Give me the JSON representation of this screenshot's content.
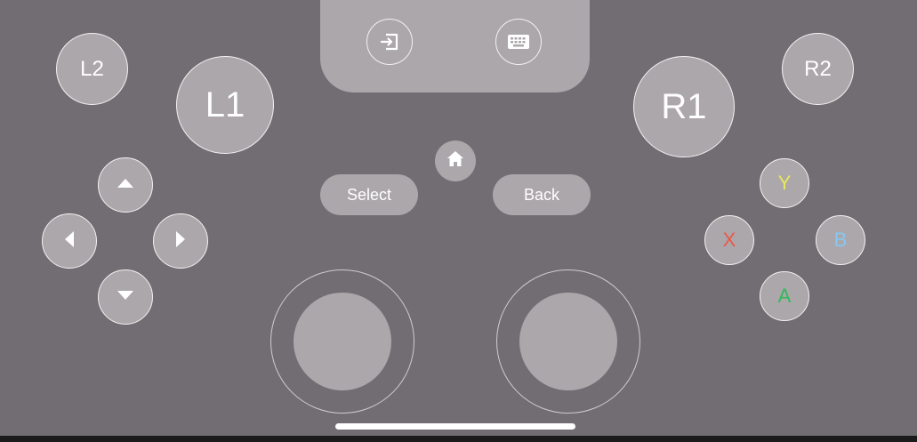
{
  "top_panel": {
    "buttons": [
      {
        "icon": "exit-icon"
      },
      {
        "icon": "keyboard-icon"
      }
    ]
  },
  "shoulders": {
    "l2": "L2",
    "l1": "L1",
    "r1": "R1",
    "r2": "R2"
  },
  "center": {
    "home_icon": "home-icon",
    "select_label": "Select",
    "back_label": "Back"
  },
  "dpad": {
    "up_icon": "arrow-up-icon",
    "left_icon": "arrow-left-icon",
    "right_icon": "arrow-right-icon",
    "down_icon": "arrow-down-icon"
  },
  "face_buttons": {
    "y": {
      "label": "Y",
      "color": "#e8e85a"
    },
    "x": {
      "label": "X",
      "color": "#e8584a"
    },
    "b": {
      "label": "B",
      "color": "#86c8ef"
    },
    "a": {
      "label": "A",
      "color": "#33b95a"
    }
  },
  "colors": {
    "background": "#726d72",
    "button_fill": "#aca7ab",
    "button_text": "#ffffff"
  }
}
